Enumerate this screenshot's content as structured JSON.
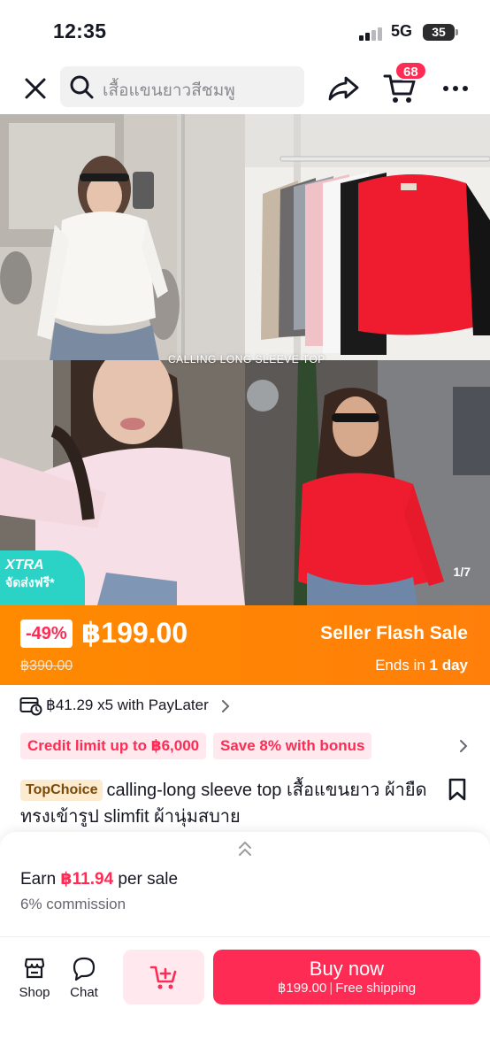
{
  "status_bar": {
    "time": "12:35",
    "network": "5G",
    "battery": "35"
  },
  "header": {
    "search_query": "เสื้อแขนยาวสีชมพู",
    "cart_count": "68",
    "icons": [
      "close-icon",
      "search-icon",
      "share-icon",
      "cart-icon",
      "more-icon"
    ]
  },
  "gallery": {
    "caption": "CALLING LONG SLEEVE TOP",
    "counter": "1/7",
    "xtra_label": "XTRA",
    "free_shipping_label": "จัดส่งฟรี*"
  },
  "price": {
    "discount": "-49%",
    "current": "฿199.00",
    "original": "฿390.00",
    "flash_title": "Seller Flash Sale",
    "ends_prefix": "Ends in ",
    "ends_value": "1 day",
    "banner_color": "#ff8a00"
  },
  "paylater": {
    "text": "฿41.29 x5 with PayLater"
  },
  "credit": {
    "tags": [
      "Credit limit up to ฿6,000",
      "Save 8% with bonus"
    ]
  },
  "product": {
    "badge": "TopChoice",
    "title": "calling-long sleeve top เสื้อแขนยาว ผ้ายืดทรงเข้ารูป slimfit ผ้านุ่มสบาย"
  },
  "affiliate": {
    "earn_prefix": "Earn ",
    "earn_amount": "฿11.94",
    "earn_suffix": " per sale",
    "commission": "6% commission"
  },
  "bottom_bar": {
    "shop_label": "Shop",
    "chat_label": "Chat",
    "buy_label": "Buy now",
    "buy_price": "฿199.00",
    "buy_shipping": "Free shipping",
    "accent": "#fe2c55"
  }
}
